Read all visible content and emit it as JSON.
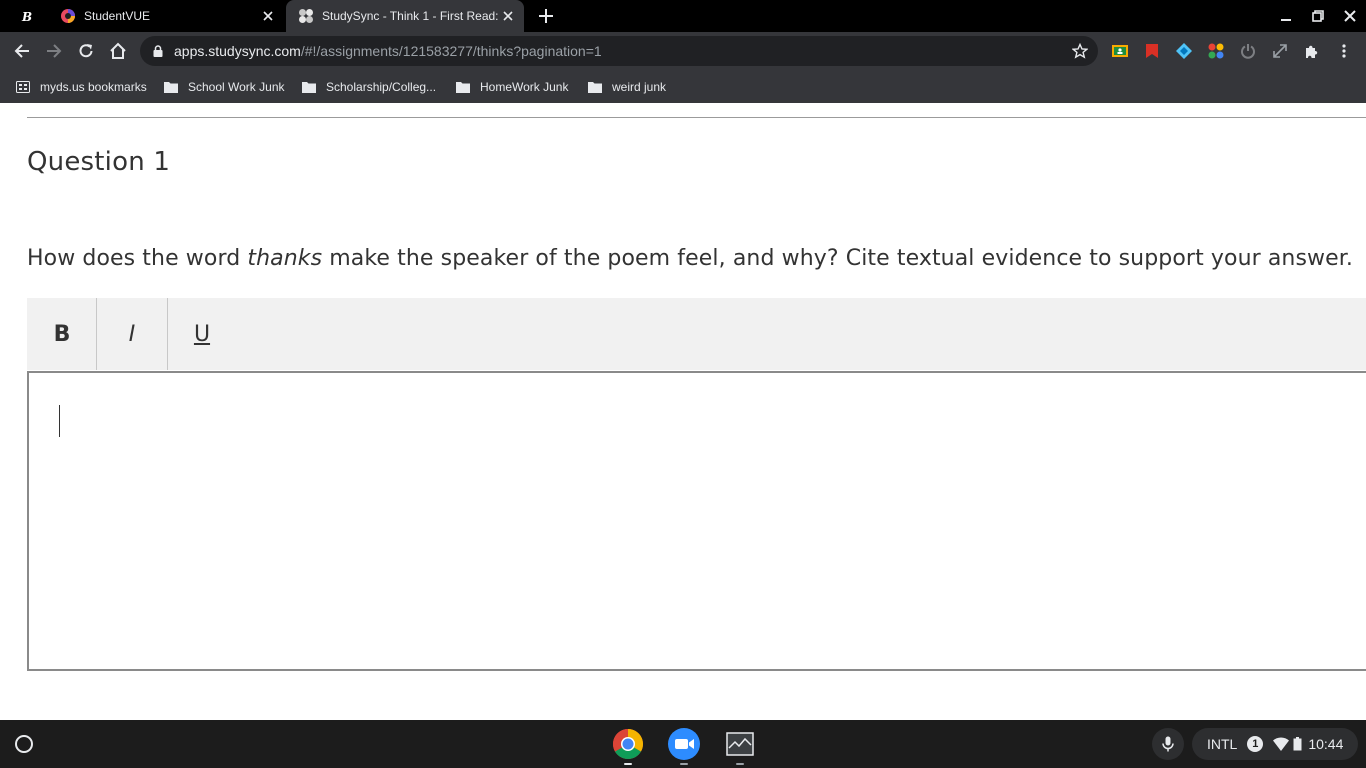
{
  "browser": {
    "tabs": [
      {
        "title": "StudentVUE",
        "active": false,
        "favicon": "studentvue-icon"
      },
      {
        "title": "StudySync - Think 1 - First Read:",
        "active": true,
        "favicon": "studysync-icon"
      }
    ],
    "pinned_tab_icon": "bold-b-icon",
    "new_tab_label": "+",
    "url_host": "apps.studysync.com",
    "url_path": "/#!/assignments/121583277/thinks?pagination=1",
    "bookmarks": [
      "myds.us bookmarks",
      "School Work Junk",
      "Scholarship/Colleg...",
      "HomeWork Junk",
      "weird junk"
    ]
  },
  "page": {
    "question_title": "Question 1",
    "question_before": "How does the word ",
    "question_emphasis": "thanks",
    "question_after": " make the speaker of the poem feel, and why? Cite textual evidence to support your answer.",
    "toolbar": {
      "bold_label": "B",
      "italic_label": "I",
      "underline_label": "U"
    },
    "answer_value": ""
  },
  "shelf": {
    "apps": [
      "chrome-icon",
      "zoom-icon",
      "screen-app-icon"
    ],
    "input_method": "INTL",
    "notification_count": "1",
    "time": "10:44"
  },
  "colors": {
    "chrome_dark": "#35363a",
    "tabstrip": "#000000",
    "omnibox": "#202124",
    "text_dark": "#333333",
    "editor_toolbar": "#f1f1f1"
  }
}
